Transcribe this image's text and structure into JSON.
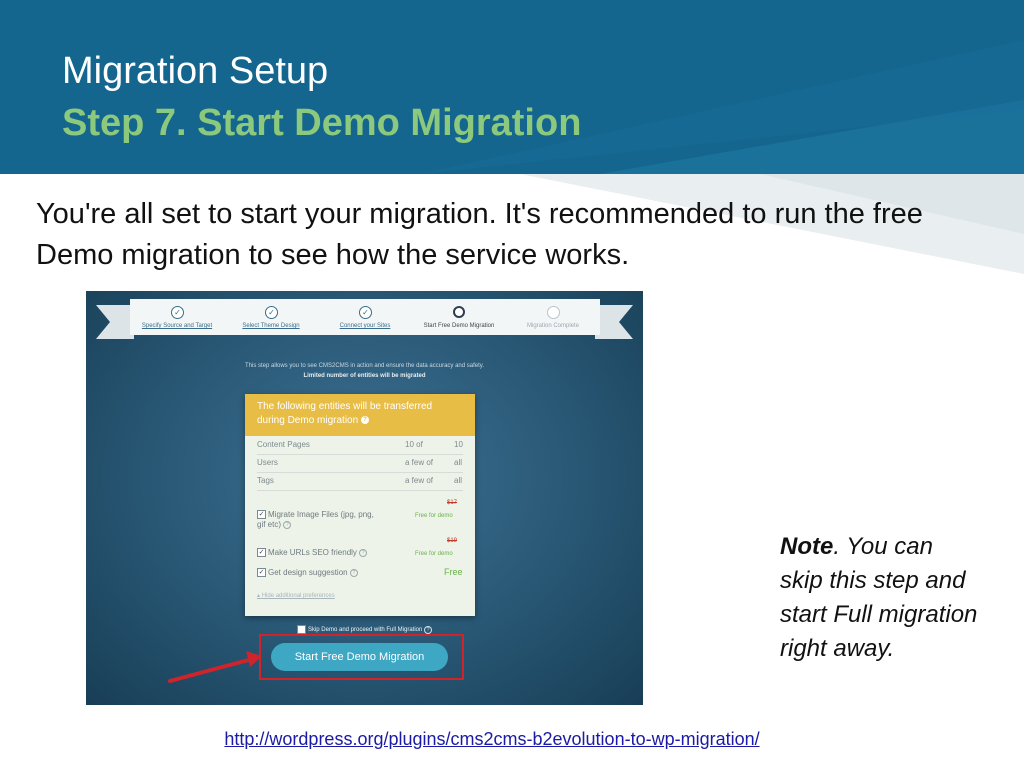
{
  "header": {
    "title": "Migration Setup",
    "subtitle": "Step 7. Start Demo Migration"
  },
  "intro": "You're all set to start your migration. It's recommended to run the free Demo migration to see how the service works.",
  "screenshot": {
    "steps": [
      {
        "label": "Specify Source and Target",
        "state": "done"
      },
      {
        "label": "Select Theme Design",
        "state": "done"
      },
      {
        "label": "Connect your Sites",
        "state": "done"
      },
      {
        "label": "Start Free Demo Migration",
        "state": "current"
      },
      {
        "label": "Migration Complete",
        "state": "todo"
      }
    ],
    "info_line1": "This step allows you to see CMS2CMS in action and ensure the data accuracy and safety.",
    "info_line2": "Limited number of entities will be migrated",
    "card": {
      "header_line1": "The following entities will be transferred",
      "header_line2": "during Demo migration",
      "entities": [
        {
          "name": "Content Pages",
          "count": "10 of",
          "total": "10"
        },
        {
          "name": "Users",
          "count": "a few of",
          "total": "all"
        },
        {
          "name": "Tags",
          "count": "a few of",
          "total": "all"
        }
      ],
      "options": [
        {
          "label_line1": "Migrate Image Files (jpg, png,",
          "label_line2": "gif etc)",
          "old_price": "$17",
          "price": "Free for demo"
        },
        {
          "label_line1": "Make URLs SEO friendly",
          "old_price": "$19",
          "price": "Free for demo"
        },
        {
          "label_line1": "Get design suggestion",
          "price": "Free"
        }
      ],
      "hide_link": "Hide additional preferences"
    },
    "skip_label": "Skip Demo and proceed with Full Migration",
    "start_button": "Start Free Demo Migration"
  },
  "note": {
    "bold": "Note",
    "text": ". You can skip this step and start Full migration right away."
  },
  "link": "http://wordpress.org/plugins/cms2cms-b2evolution-to-wp-migration/",
  "colors": {
    "header_bg": "#14668f",
    "subtitle": "#8cc97c",
    "card_header": "#e8bd45",
    "button": "#3ea7c4",
    "highlight": "#d0232a"
  }
}
